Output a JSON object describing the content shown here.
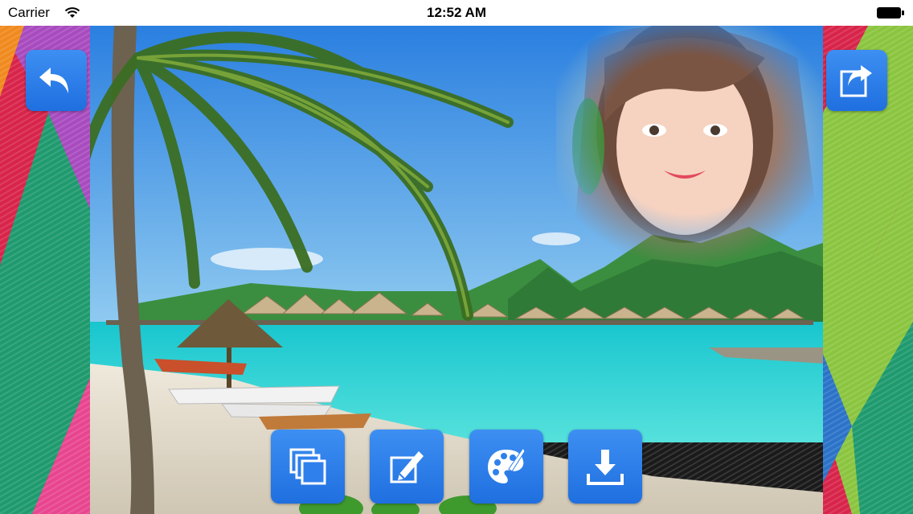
{
  "status_bar": {
    "carrier": "Carrier",
    "time": "12:52 AM"
  },
  "toolbar": {
    "back_icon": "back-arrow-icon",
    "share_icon": "share-icon"
  },
  "bottom_actions": [
    {
      "icon": "frames-stack-icon"
    },
    {
      "icon": "edit-pencil-icon"
    },
    {
      "icon": "palette-icon"
    },
    {
      "icon": "download-icon"
    }
  ],
  "colors": {
    "button_blue": "#2f80ed",
    "status_bar_bg": "#ffffff",
    "sea": "#2fd3d6",
    "sky": "#2f8fe6"
  }
}
